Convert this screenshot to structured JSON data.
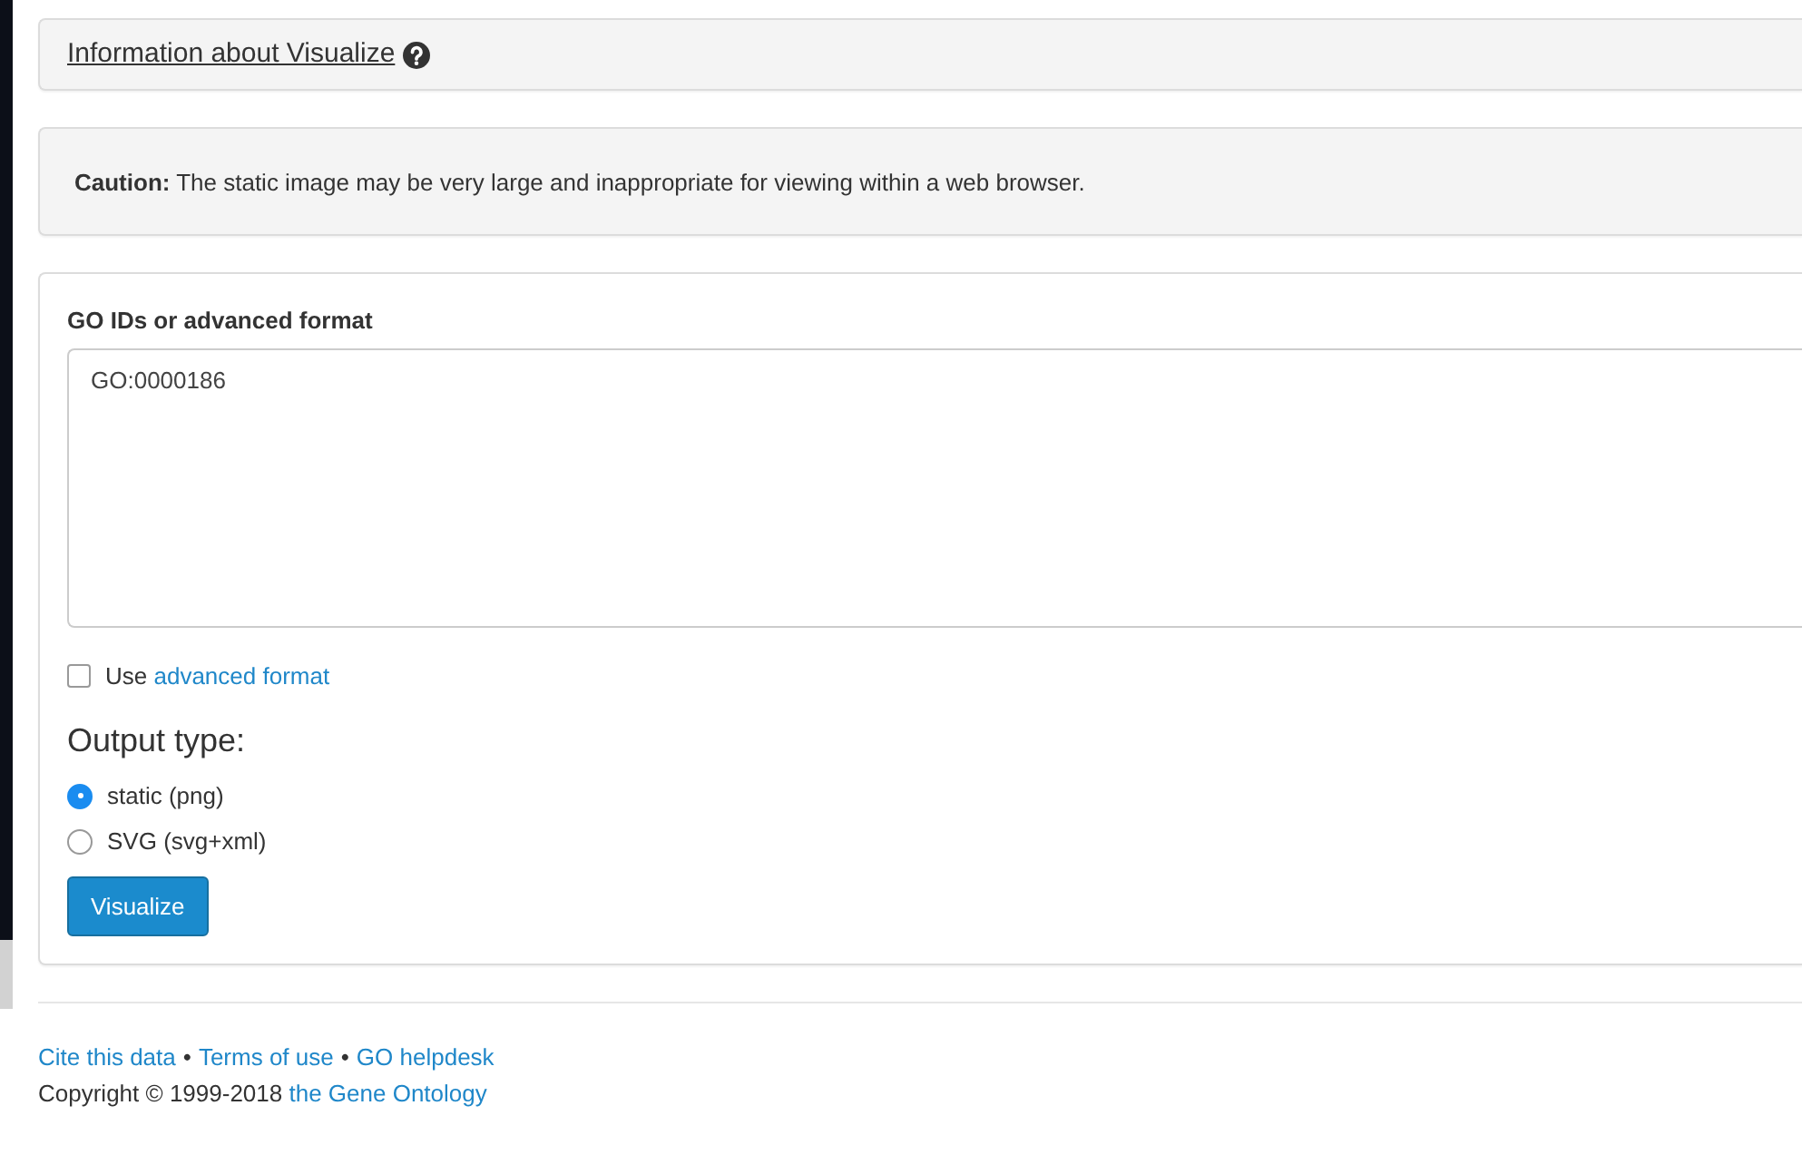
{
  "info_panel": {
    "title": "Information about Visualize"
  },
  "caution": {
    "text": "**Caution:** The static image may be very large and inappropriate for viewing within a web browser."
  },
  "form": {
    "input_label": "GO IDs or advanced format",
    "input_value": "GO:0000186",
    "advanced_option": {
      "prefix": "Use",
      "link": "advanced format",
      "checked": false
    },
    "output_heading": "Output type:",
    "output_options": [
      {
        "label": "static (png)",
        "selected": true
      },
      {
        "label": "SVG (svg+xml)",
        "selected": false
      }
    ],
    "submit": "Visualize"
  },
  "footer": {
    "items": [
      {
        "kind": "link",
        "text": "Cite this data"
      },
      {
        "kind": "separator",
        "text": "•"
      },
      {
        "kind": "link",
        "text": "Terms of use"
      },
      {
        "kind": "separator",
        "text": "•"
      },
      {
        "kind": "link",
        "text": "GO helpdesk"
      }
    ],
    "copyright": "Copyright © 1999-2018",
    "copyright_link": "the Gene Ontology"
  }
}
